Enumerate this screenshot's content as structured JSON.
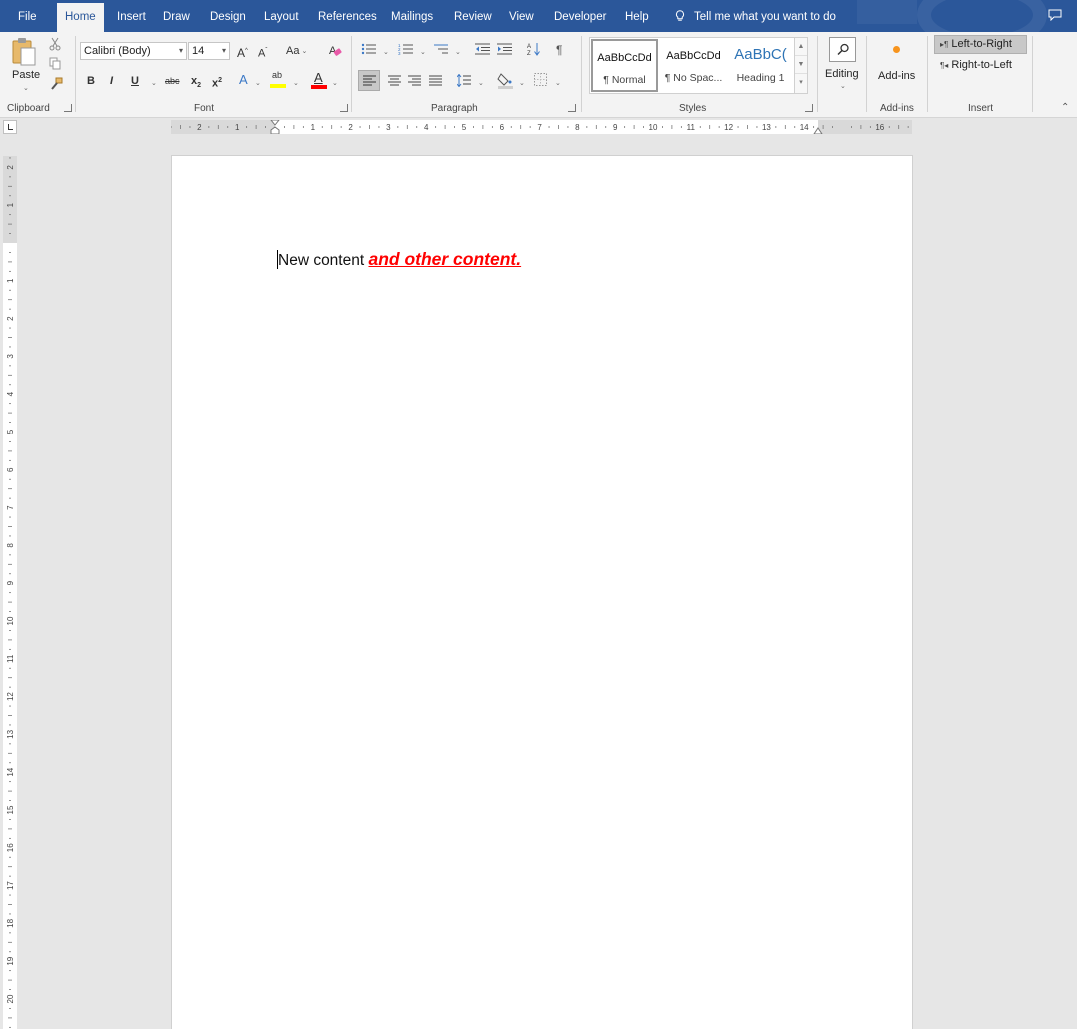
{
  "tabs": [
    "File",
    "Home",
    "Insert",
    "Draw",
    "Design",
    "Layout",
    "References",
    "Mailings",
    "Review",
    "View",
    "Developer",
    "Help"
  ],
  "tell_me": "Tell me what you want to do",
  "clipboard": {
    "paste_label": "Paste",
    "group_label": "Clipboard"
  },
  "font": {
    "font_name": "Calibri (Body)",
    "font_size": "14",
    "change_case": "Aa",
    "group_label": "Font"
  },
  "paragraph": {
    "group_label": "Paragraph"
  },
  "styles": {
    "items": [
      {
        "preview": "AaBbCcDd",
        "name": "¶ Normal"
      },
      {
        "preview": "AaBbCcDd",
        "name": "¶ No Spac..."
      },
      {
        "preview": "AaBbC(",
        "name": "Heading 1"
      }
    ],
    "group_label": "Styles"
  },
  "editing": {
    "label": "Editing"
  },
  "addins": {
    "label": "Add-ins",
    "group_label": "Add-ins"
  },
  "insert_group": {
    "ltr_label": "Left-to-Right",
    "rtl_label": "Right-to-Left",
    "group_label": "Insert"
  },
  "ruler": {
    "h_numbers": [
      "3",
      "2",
      "1",
      "1",
      "2",
      "3",
      "4",
      "5",
      "6",
      "7",
      "8",
      "9",
      "10",
      "11",
      "12",
      "13",
      "14",
      "16",
      "17"
    ],
    "v_numbers": [
      "2",
      "1",
      "1",
      "2",
      "3",
      "4",
      "5",
      "6",
      "7",
      "8",
      "9",
      "10",
      "11",
      "12",
      "13",
      "14",
      "15",
      "16",
      "17",
      "18",
      "19",
      "20",
      "21",
      "22"
    ]
  },
  "document": {
    "plain_text": "New content ",
    "rich_text": "and other content."
  },
  "colors": {
    "accent": "#2b579a",
    "highlight": "#ffff00",
    "font_color": "#ff0000",
    "addins_dot": "#f7941d"
  }
}
